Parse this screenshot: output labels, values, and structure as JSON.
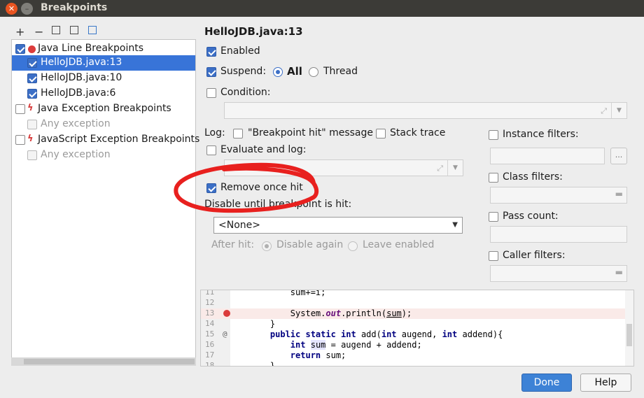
{
  "window": {
    "title": "Breakpoints",
    "close_glyph": "✕",
    "minimize_glyph": "–"
  },
  "toolbar": {
    "add": "+",
    "remove": "−"
  },
  "tree": {
    "groups": [
      {
        "label": "Java Line Breakpoints",
        "icon": "breakpoint-dot-icon",
        "checked": true,
        "items": [
          {
            "label": "HelloJDB.java:13",
            "checked": true,
            "selected": true
          },
          {
            "label": "HelloJDB.java:10",
            "checked": true
          },
          {
            "label": "HelloJDB.java:6",
            "checked": true
          }
        ]
      },
      {
        "label": "Java Exception Breakpoints",
        "icon": "exception-bolt-icon",
        "checked": false,
        "items": [
          {
            "label": "Any exception",
            "checked": false,
            "disabled": true
          }
        ]
      },
      {
        "label": "JavaScript Exception Breakpoints",
        "icon": "exception-bolt-icon",
        "checked": false,
        "items": [
          {
            "label": "Any exception",
            "checked": false,
            "disabled": true
          }
        ]
      }
    ]
  },
  "details": {
    "header": "HelloJDB.java:13",
    "enabled_label": "Enabled",
    "suspend_label": "Suspend:",
    "suspend_all": "All",
    "suspend_thread": "Thread",
    "condition_label": "Condition:",
    "log_label": "Log:",
    "log_message": "\"Breakpoint hit\" message",
    "log_stack": "Stack trace",
    "evaluate_label": "Evaluate and log:",
    "remove_once_label": "Remove once hit",
    "disable_until_label": "Disable until breakpoint is hit:",
    "disable_until_value": "<None>",
    "after_hit_label": "After hit:",
    "after_disable": "Disable again",
    "after_leave": "Leave enabled",
    "instance_filters": "Instance filters:",
    "class_filters": "Class filters:",
    "pass_count": "Pass count:",
    "caller_filters": "Caller filters:",
    "ellipsis": "...",
    "expand_glyph": "⤢",
    "dropdown_glyph": "▼",
    "folder_glyph": "▬"
  },
  "editor": {
    "lines": [
      {
        "num": "11",
        "text": "        sum+=i;"
      },
      {
        "num": "12",
        "text": ""
      },
      {
        "num": "13",
        "text": "        System.out.println(sum);",
        "breakpoint": true
      },
      {
        "num": "14",
        "text": "    }"
      },
      {
        "num": "15",
        "text": "    public static int add(int augend, int addend){",
        "override": true
      },
      {
        "num": "16",
        "text": "        int sum = augend + addend;"
      },
      {
        "num": "17",
        "text": "        return sum;"
      },
      {
        "num": "18",
        "text": "    }"
      }
    ],
    "override_glyph": "@"
  },
  "buttons": {
    "done": "Done",
    "help": "Help"
  },
  "annotation_color": "#e8201e"
}
